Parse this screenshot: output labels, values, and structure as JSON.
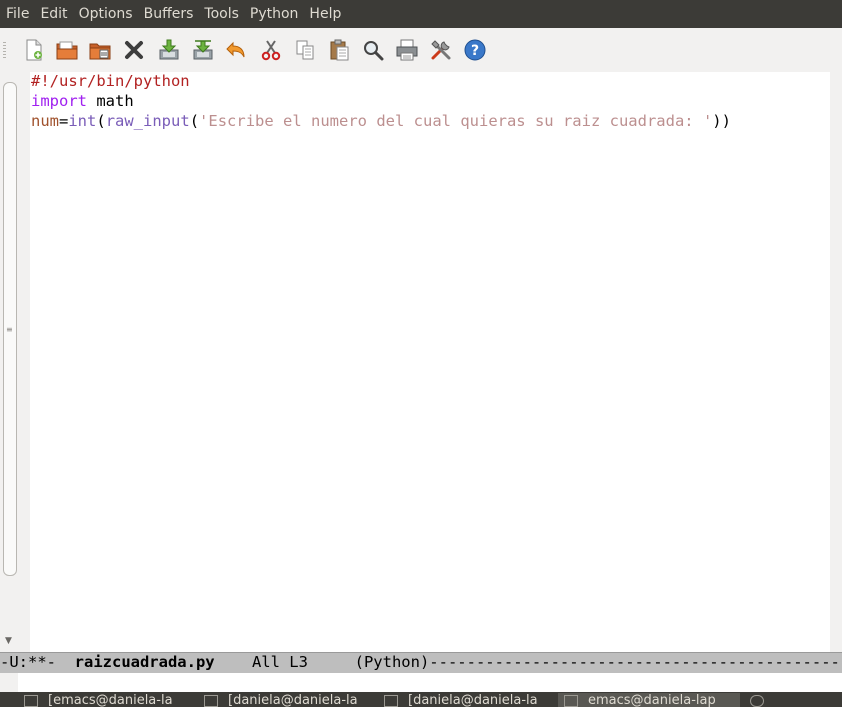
{
  "menubar": {
    "items": [
      "File",
      "Edit",
      "Options",
      "Buffers",
      "Tools",
      "Python",
      "Help"
    ]
  },
  "toolbar": {
    "buttons": [
      {
        "name": "new-file",
        "icon": "new-file-icon"
      },
      {
        "name": "open-file",
        "icon": "open-folder-icon"
      },
      {
        "name": "open-directory",
        "icon": "directory-icon"
      },
      {
        "name": "close-buffer",
        "icon": "close-icon"
      },
      {
        "name": "save",
        "icon": "save-icon"
      },
      {
        "name": "save-as",
        "icon": "save-as-icon"
      },
      {
        "name": "undo",
        "icon": "undo-icon"
      },
      {
        "name": "cut",
        "icon": "scissors-icon"
      },
      {
        "name": "copy",
        "icon": "copy-icon"
      },
      {
        "name": "paste",
        "icon": "paste-icon"
      },
      {
        "name": "search",
        "icon": "search-icon"
      },
      {
        "name": "print",
        "icon": "printer-icon"
      },
      {
        "name": "preferences",
        "icon": "tools-icon"
      },
      {
        "name": "help",
        "icon": "help-icon"
      }
    ]
  },
  "editor": {
    "line1": "#!/usr/bin/python",
    "line2_keyword": "import",
    "line2_rest": " math",
    "line3_var": "num",
    "line3_eq": "=",
    "line3_int": "int",
    "line3_paren1": "(",
    "line3_func": "raw_input",
    "line3_paren2": "(",
    "line3_string": "'Escribe el numero del cual quieras su raiz cuadrada: '",
    "line3_close": "))"
  },
  "modeline": {
    "status": "-U:**-  ",
    "buffer_name": "raizcuadrada.py",
    "position": "    All L3     ",
    "mode": "(Python)",
    "fill": "-----------------------------------------------------------"
  },
  "taskbar": {
    "tasks": [
      {
        "label": "[emacs@daniela-la",
        "active": false
      },
      {
        "label": "[daniela@daniela-la",
        "active": false
      },
      {
        "label": "[daniela@daniela-la",
        "active": false
      },
      {
        "label": "emacs@daniela-lap",
        "active": true
      }
    ]
  },
  "colors": {
    "menubar_bg": "#3c3b37",
    "comment": "#b22222",
    "keyword": "#a020f0",
    "variable": "#a0522d",
    "string": "#bc8f8f",
    "modeline_bg": "#bebebe"
  }
}
